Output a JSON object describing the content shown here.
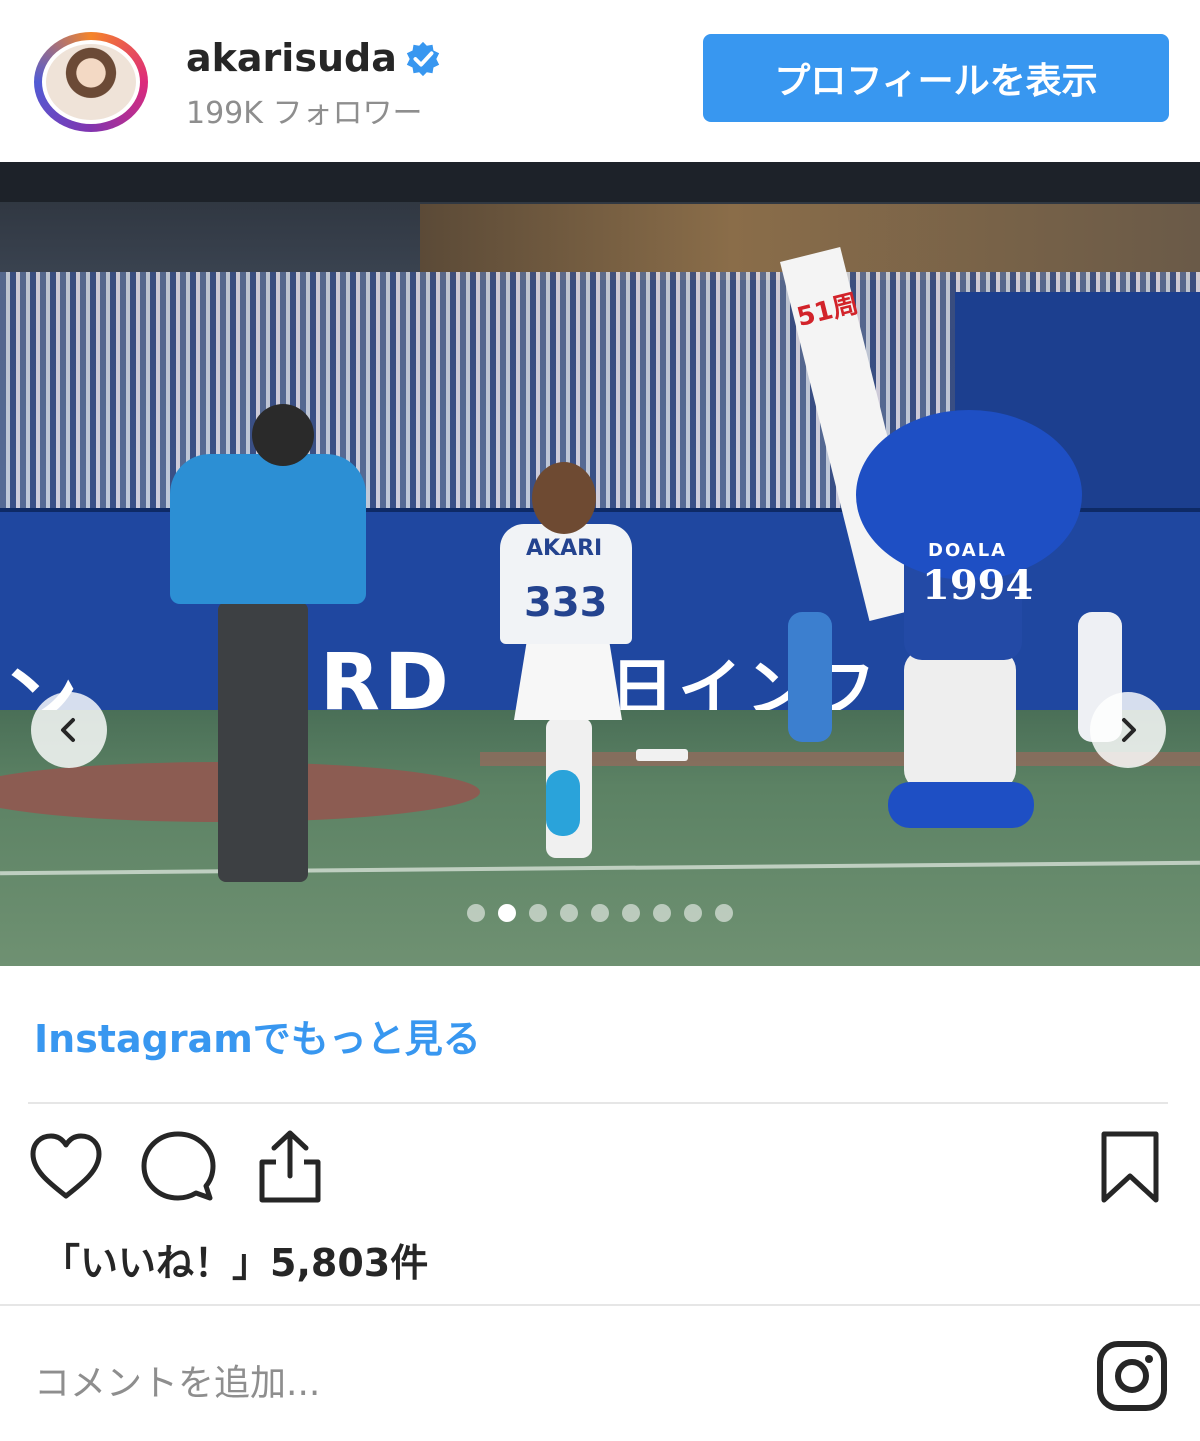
{
  "header": {
    "username": "akarisuda",
    "followers": "199K フォロワー",
    "profile_button": "プロフィールを表示"
  },
  "photo": {
    "player_name": "AKARI",
    "player_number": "333",
    "mascot_name": "DOALA",
    "mascot_number": "1994",
    "banner_text": "51周",
    "wall_text_left": "ン",
    "wall_text_mid": "RD",
    "wall_text_right": "日インフ",
    "carousel": {
      "total": 9,
      "active_index": 1
    }
  },
  "footer": {
    "more_link": "Instagramでもっと見る",
    "likes": "「いいね！」5,803件",
    "comment_placeholder": "コメントを追加..."
  },
  "colors": {
    "accent": "#3897f0",
    "text": "#262626",
    "muted": "#8e8e8e",
    "verified": "#3897f0"
  },
  "icons": [
    "verified-badge-icon",
    "chevron-left-icon",
    "chevron-right-icon",
    "heart-icon",
    "comment-icon",
    "share-icon",
    "bookmark-icon",
    "instagram-logo-icon"
  ]
}
